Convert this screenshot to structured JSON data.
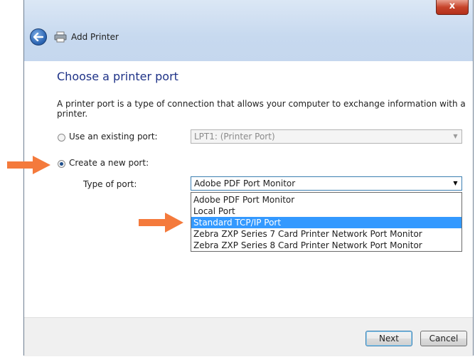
{
  "window": {
    "title": "Add Printer",
    "close_label": "x"
  },
  "page": {
    "heading": "Choose a printer port",
    "description": "A printer port is a type of connection that allows your computer to exchange information with a printer."
  },
  "options": {
    "existing": {
      "label": "Use an existing port:",
      "value": "LPT1: (Printer Port)",
      "checked": false
    },
    "new": {
      "label": "Create a new port:",
      "checked": true
    }
  },
  "port_type": {
    "label": "Type of port:",
    "selected": "Adobe PDF Port Monitor",
    "options": [
      "Adobe PDF Port Monitor",
      "Local Port",
      "Standard TCP/IP Port",
      "Zebra ZXP Series 7 Card Printer Network Port Monitor",
      "Zebra ZXP Series 8 Card Printer Network Port Monitor"
    ],
    "highlighted_index": 2
  },
  "buttons": {
    "next": "Next",
    "cancel": "Cancel"
  },
  "colors": {
    "annotation_arrow": "#f47a3c",
    "highlight": "#3399ff",
    "heading": "#1e3287"
  },
  "icons": {
    "back": "back-arrow-icon",
    "printer": "printer-icon"
  }
}
